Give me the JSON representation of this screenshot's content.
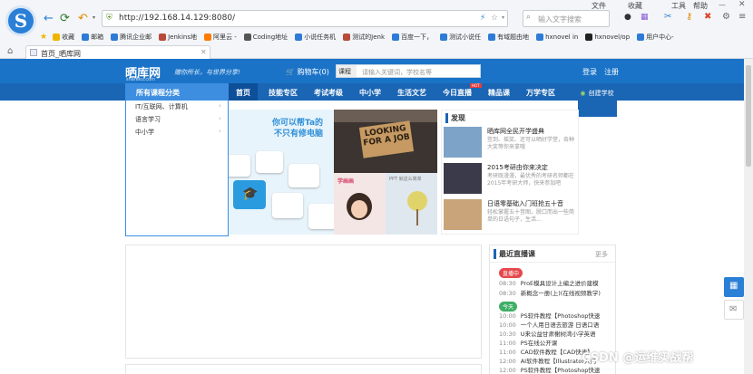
{
  "browser": {
    "menu": [
      "文件",
      "收藏",
      "工具",
      "帮助"
    ],
    "url": "http://192.168.14.129:8080/",
    "search_placeholder": "输入文字搜索",
    "bookmarks": [
      {
        "label": "收藏",
        "color": "#f0b400"
      },
      {
        "label": "邮箱",
        "color": "#2d7bd6"
      },
      {
        "label": "腾讯企业邮",
        "color": "#2d7bd6"
      },
      {
        "label": "Jenkins地",
        "color": "#b94a3b"
      },
      {
        "label": "阿里云 -",
        "color": "#ff7a00"
      },
      {
        "label": "Coding地址",
        "color": "#555555"
      },
      {
        "label": "小说任务机",
        "color": "#2d7bd6"
      },
      {
        "label": "测试的Jenk",
        "color": "#b94a3b"
      },
      {
        "label": "百度一下，",
        "color": "#2d7bd6"
      },
      {
        "label": "测试小说任",
        "color": "#2d7bd6"
      },
      {
        "label": "有域题由地",
        "color": "#2d7bd6"
      },
      {
        "label": "hxnovel in",
        "color": "#2d7bd6"
      },
      {
        "label": "hxnovel/op",
        "color": "#222222"
      },
      {
        "label": "用户中心-",
        "color": "#2d7bd6"
      }
    ],
    "tab_title": "首页_晒库网"
  },
  "site": {
    "logo": "晒库网",
    "logo_sub": "shareku.com",
    "slogan": "赠你所长，与世界分享!",
    "cart": "购物车(0)",
    "search_select": "课程",
    "search_placeholder": "请输入关键词，学校名等",
    "login": "登录",
    "register": "注册"
  },
  "nav": {
    "category": "所有课程分类",
    "items": [
      "首页",
      "技能专区",
      "考试考级",
      "中小学",
      "生活文艺",
      "今日直播",
      "精品课",
      "万学专区"
    ],
    "hot_badge": "HOT",
    "user": "创建学校"
  },
  "categories": [
    "IT/互联网、计算机",
    "语言学习",
    "中小学"
  ],
  "banner": {
    "line1": "你可以帮Ta的",
    "line2": "不只有修电脑"
  },
  "tiles": {
    "job_sign": "LOOKING FOR A JOB",
    "girl_label": "学画画",
    "ppt_label": "PPT 就这么简单"
  },
  "discover": {
    "title": "发现",
    "items": [
      {
        "title": "晒库网全民开学盛典",
        "desc": "签到、摇奖、还可以晒好学堂，各种大奖等你来拿哦",
        "thumb": "#7ea3c8"
      },
      {
        "title": "2015考研由你来决定",
        "desc": "考研既漫漫，最优秀的考研名师都在2015年考研大师，快来参加吧",
        "thumb": "#3a3a4a"
      },
      {
        "title": "日语零基础入门班抢五十音",
        "desc": "轻松掌握五十音图，脱口而出一些简单的日语句子，生活...",
        "thumb": "#c9a47a"
      }
    ]
  },
  "live": {
    "title": "最近直播课",
    "more": "更多",
    "badge_live": "直播中",
    "badge_today": "今天",
    "items": [
      {
        "time": "08:30",
        "text": "ProE模具设计上编之进价建模"
      },
      {
        "time": "08:30",
        "text": "新概念一册(上)(在线视频教学)"
      },
      {
        "time": "10:00",
        "text": "PS软件教程【Photoshop快速"
      },
      {
        "time": "10:00",
        "text": "一个人用日语去旅游 日语口语"
      },
      {
        "time": "10:30",
        "text": "U来公益甘肃榭树湾小学英语"
      },
      {
        "time": "11:00",
        "text": "PS在线公开课"
      },
      {
        "time": "11:00",
        "text": "CAD软件教程【CAD快速】"
      },
      {
        "time": "12:00",
        "text": "AI软件教程【Illustrator入门"
      },
      {
        "time": "12:00",
        "text": "PS软件教程【Photoshop快速"
      }
    ]
  },
  "watermark": "CSDN @运维实战帮"
}
